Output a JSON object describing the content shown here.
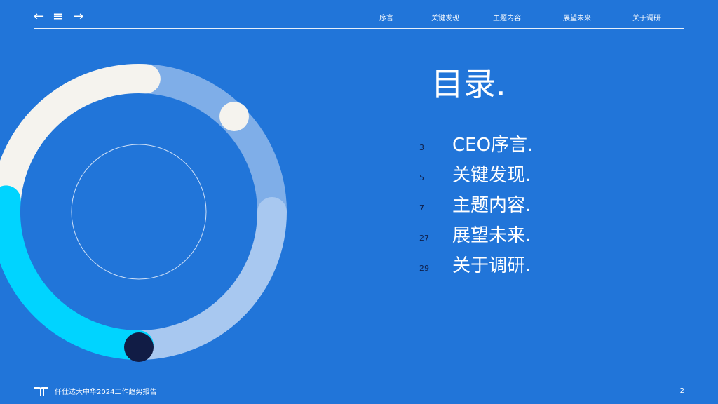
{
  "nav": {
    "back_icon": "arrow-left-icon",
    "menu_icon": "menu-icon",
    "forward_icon": "arrow-right-icon",
    "items": [
      "序言",
      "关键发现",
      "主题内容",
      "展望未来",
      "关于调研"
    ]
  },
  "toc": {
    "title": "目录.",
    "entries": [
      {
        "page": "3",
        "label": "CEO序言."
      },
      {
        "page": "5",
        "label": "关键发现."
      },
      {
        "page": "7",
        "label": "主题内容."
      },
      {
        "page": "27",
        "label": "展望未来."
      },
      {
        "page": "29",
        "label": "关于调研."
      }
    ]
  },
  "footer": {
    "report_title": "仟仕达大中华2024工作趋势报告",
    "page_number": "2"
  },
  "colors": {
    "background": "#2175d9",
    "cream": "#f5f3ee",
    "light_blue": "#7faee8",
    "pale_blue": "#a8c8f0",
    "cyan": "#00d4ff",
    "navy": "#111c45"
  }
}
